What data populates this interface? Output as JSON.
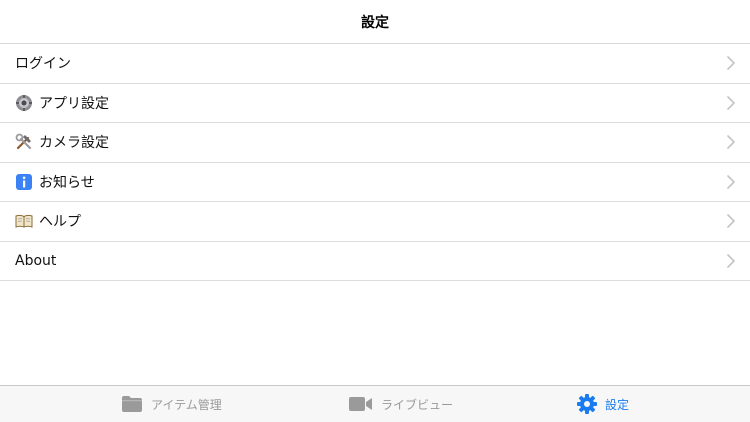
{
  "navbar": {
    "title": "設定"
  },
  "menu": {
    "items": [
      {
        "label": "ログイン",
        "icon": ""
      },
      {
        "label": "アプリ設定",
        "icon": "gear-emoji-icon"
      },
      {
        "label": "カメラ設定",
        "icon": "hammer-wrench-icon"
      },
      {
        "label": "お知らせ",
        "icon": "info-icon"
      },
      {
        "label": "ヘルプ",
        "icon": "open-book-icon"
      },
      {
        "label": "About",
        "icon": ""
      }
    ]
  },
  "tabbar": {
    "tabs": [
      {
        "label": "アイテム管理",
        "icon": "folder-icon",
        "active": false
      },
      {
        "label": "ライブビュー",
        "icon": "video-camera-icon",
        "active": false
      },
      {
        "label": "設定",
        "icon": "gear-icon",
        "active": true
      }
    ]
  },
  "colors": {
    "accent": "#1b7cf0",
    "inactive_tab": "#9a9a9a",
    "separator": "#dcdcdc",
    "tabbar_bg": "#f7f7f7"
  }
}
